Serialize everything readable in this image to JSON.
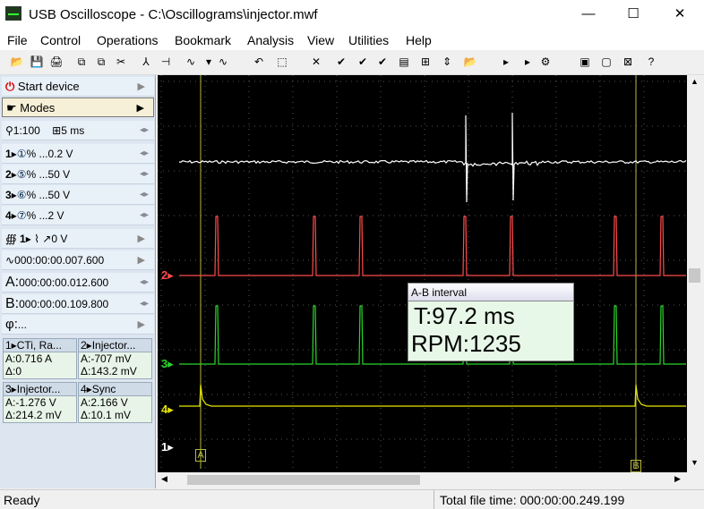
{
  "window": {
    "title": "USB Oscilloscope - C:\\Oscillograms\\injector.mwf",
    "minimize": "—",
    "maximize": "☐",
    "close": "✕"
  },
  "menu": [
    "File",
    "Control",
    "Operations",
    "Bookmark",
    "Analysis",
    "View",
    "Utilities",
    "Help"
  ],
  "toolbar_icons": [
    "open-icon",
    "save-icon",
    "print-icon",
    "copy-icon",
    "paste-icon",
    "cut-icon",
    "cursor-icon",
    "marker-icon",
    "measure-icon",
    "dropdown-icon",
    "filter-icon",
    "undo-icon",
    "zoom-icon",
    "delete-icon",
    "check-icon",
    "check2-icon",
    "check3-icon",
    "doc-icon",
    "grid-icon",
    "scale-icon",
    "folder-icon",
    "play-icon",
    "step-icon",
    "settings-icon",
    "image-icon",
    "page-icon",
    "clear-icon",
    "help-icon"
  ],
  "panel": {
    "start_device": "Start device",
    "modes": "Modes",
    "zoom": "1:100",
    "timebase": "5 ms",
    "channels": [
      {
        "num": "1",
        "probe": "①",
        "value": "0.2 V"
      },
      {
        "num": "2",
        "probe": "⑤",
        "value": "50 V"
      },
      {
        "num": "3",
        "probe": "⑥",
        "value": "50 V"
      },
      {
        "num": "4",
        "probe": "⑦",
        "value": "2 V"
      }
    ],
    "trigger_ch": "1",
    "trigger_level": "0 V",
    "trigger_time": "000:00:00.007.600",
    "cursor_a_label": "A:",
    "cursor_a": "000:00:00.012.600",
    "cursor_b_label": "B:",
    "cursor_b": "000:00:00.109.800",
    "phi_label": "φ:",
    "phi": "...",
    "measure_boxes": [
      {
        "head": "1▸CTi, Ra...",
        "a": "A:0.716 A",
        "d": "Δ:0"
      },
      {
        "head": "2▸Injector...",
        "a": "A:-707 mV",
        "d": "Δ:143.2 mV"
      },
      {
        "head": "3▸Injector...",
        "a": "A:-1.276 V",
        "d": "Δ:214.2 mV"
      },
      {
        "head": "4▸Sync",
        "a": "A:2.166 V",
        "d": "Δ:10.1 mV"
      }
    ]
  },
  "ab_interval": {
    "title": "A-B interval",
    "t": "T:97.2 ms",
    "rpm": "RPM:1235"
  },
  "markers": {
    "a": "A",
    "b": "B",
    "ch1": "1",
    "ch2": "2",
    "ch3": "3",
    "ch4": "4"
  },
  "colors": {
    "ch1": "#ffffff",
    "ch2": "#ff4b4b",
    "ch3": "#2bd62b",
    "ch4": "#e6e600",
    "cursor": "#b8b840"
  },
  "status": {
    "left": "Ready",
    "right": "Total file time: 000:00:00.249.199"
  }
}
